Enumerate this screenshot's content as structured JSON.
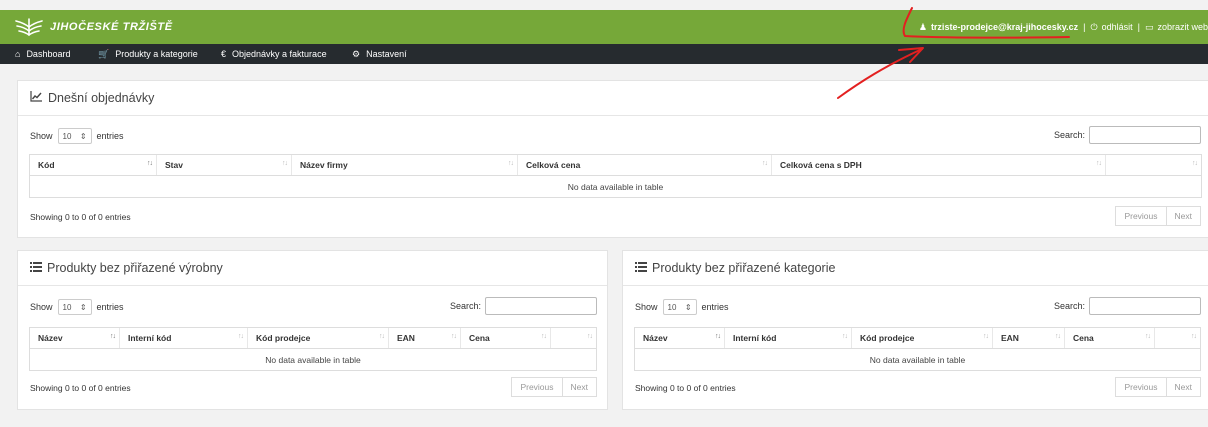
{
  "header": {
    "logo_text": "JIHOČESKÉ TRŽIŠTĚ",
    "user_email": "trziste-prodejce@kraj-jihocesky.cz",
    "logout_label": "odhlásit",
    "view_web_label": "zobrazit web"
  },
  "nav": {
    "items": [
      {
        "label": "Dashboard",
        "icon": "home-icon"
      },
      {
        "label": "Produkty a kategorie",
        "icon": "cart-icon"
      },
      {
        "label": "Objednávky a fakturace",
        "icon": "euro-icon"
      },
      {
        "label": "Nastavení",
        "icon": "gear-icon"
      }
    ]
  },
  "common": {
    "show_label": "Show",
    "page_length": "10",
    "entries_label": "entries",
    "search_label": "Search:",
    "empty_text": "No data available in table",
    "info_text": "Showing 0 to 0 of 0 entries",
    "previous_label": "Previous",
    "next_label": "Next"
  },
  "orders_panel": {
    "title": "Dnešní objednávky",
    "icon": "line-chart-icon",
    "columns": [
      "Kód",
      "Stav",
      "Název firmy",
      "Celková cena",
      "Celková cena s DPH",
      ""
    ]
  },
  "no_manufacturer_panel": {
    "title": "Produkty bez přiřazené výrobny",
    "icon": "list-icon",
    "columns": [
      "Název",
      "Interní kód",
      "Kód prodejce",
      "EAN",
      "Cena",
      ""
    ]
  },
  "no_category_panel": {
    "title": "Produkty bez přiřazené kategorie",
    "icon": "list-icon",
    "columns": [
      "Název",
      "Interní kód",
      "Kód prodejce",
      "EAN",
      "Cena",
      ""
    ]
  },
  "colors": {
    "header_green": "#76a839",
    "navbar_dark": "#262b2f",
    "annotation_red": "#e32020"
  }
}
